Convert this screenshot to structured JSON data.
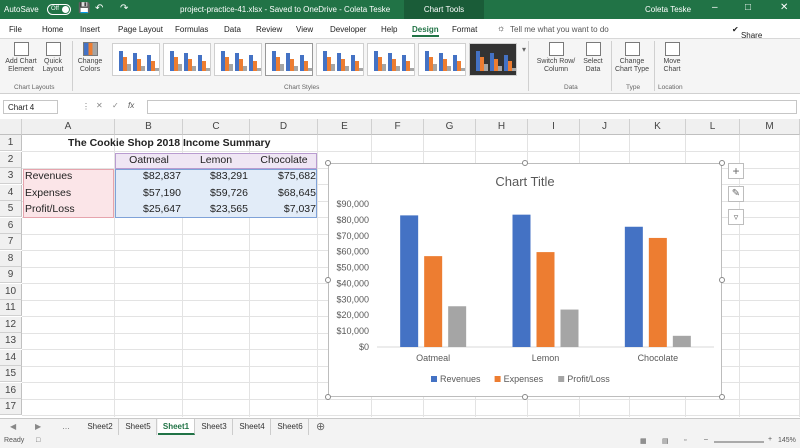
{
  "titlebar": {
    "autosave_label": "AutoSave",
    "autosave_state": "Off",
    "file_title": "project-practice-41.xlsx - Saved to OneDrive - Coleta Teske",
    "context_label": "Chart Tools",
    "user": "Coleta Teske"
  },
  "tabs": [
    "File",
    "Home",
    "Insert",
    "Page Layout",
    "Formulas",
    "Data",
    "Review",
    "View",
    "Developer",
    "Help",
    "Design",
    "Format"
  ],
  "active_tab": "Design",
  "tell_me": "Tell me what you want to do",
  "share": "Share",
  "ribbon": {
    "add_chart_element": "Add Chart Element",
    "quick_layout": "Quick Layout",
    "change_colors": "Change Colors",
    "chart_layouts_group": "Chart Layouts",
    "chart_styles_group": "Chart Styles",
    "switch_row_col": "Switch Row/ Column",
    "select_data": "Select Data",
    "data_group": "Data",
    "change_chart_type": "Change Chart Type",
    "type_group": "Type",
    "move_chart": "Move Chart",
    "location_group": "Location"
  },
  "namebox": "Chart 4",
  "fx_label": "fx",
  "columns": [
    "A",
    "B",
    "C",
    "D",
    "E",
    "F",
    "G",
    "H",
    "I",
    "J",
    "K",
    "L",
    "M"
  ],
  "rows": [
    "1",
    "2",
    "3",
    "4",
    "5",
    "6",
    "7",
    "8",
    "9",
    "10",
    "11",
    "12",
    "13",
    "14",
    "15",
    "16",
    "17"
  ],
  "sheet": {
    "title": "The Cookie Shop 2018 Income Summary",
    "headers": [
      "Oatmeal",
      "Lemon",
      "Chocolate"
    ],
    "data": [
      {
        "label": "Revenues",
        "values": [
          "$82,837",
          "$83,291",
          "$75,682"
        ]
      },
      {
        "label": "Expenses",
        "values": [
          "$57,190",
          "$59,726",
          "$68,645"
        ]
      },
      {
        "label": "Profit/Loss",
        "values": [
          "$25,647",
          "$23,565",
          "$7,037"
        ]
      }
    ]
  },
  "chart_data": {
    "type": "bar",
    "title": "Chart Title",
    "categories": [
      "Oatmeal",
      "Lemon",
      "Chocolate"
    ],
    "series": [
      {
        "name": "Revenues",
        "values": [
          82837,
          83291,
          75682
        ],
        "color": "#4472C4"
      },
      {
        "name": "Expenses",
        "values": [
          57190,
          59726,
          68645
        ],
        "color": "#ED7D31"
      },
      {
        "name": "Profit/Loss",
        "values": [
          25647,
          23565,
          7037
        ],
        "color": "#A5A5A5"
      }
    ],
    "ylim": [
      0,
      90000
    ],
    "yticks": [
      "$0",
      "$10,000",
      "$20,000",
      "$30,000",
      "$40,000",
      "$50,000",
      "$60,000",
      "$70,000",
      "$80,000",
      "$90,000"
    ],
    "legend": "bottom",
    "grid": false
  },
  "sheets": [
    "Sheet2",
    "Sheet5",
    "Sheet1",
    "Sheet3",
    "Sheet4",
    "Sheet6"
  ],
  "active_sheet": "Sheet1",
  "status": "Ready",
  "zoom": "145%"
}
